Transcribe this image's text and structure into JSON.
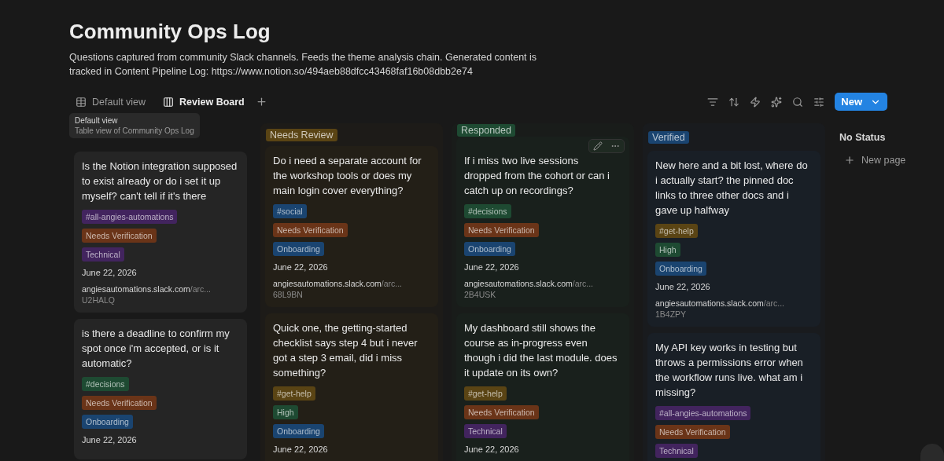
{
  "page": {
    "title": "Community Ops Log",
    "description": "Questions captured from community Slack channels. Feeds the theme analysis chain. Generated content is tracked in Content Pipeline Log: https://www.notion.so/494aeb88dfcc43468faf16b08dbb2e74"
  },
  "views": [
    {
      "kind": "table",
      "label": "Default view",
      "selected": false
    },
    {
      "kind": "board",
      "label": "Review Board",
      "selected": true
    }
  ],
  "new_button": {
    "label": "New"
  },
  "tooltip": {
    "title": "Default view",
    "subtitle": "Table view of Community Ops Log"
  },
  "columns": [
    {
      "cards": [
        {
          "question": "Is the Notion integration supposed to exist already or do i set it up myself? can't tell if it's there",
          "tags": [
            {
              "label": "#all-angies-automations",
              "color": "#42245e"
            },
            {
              "label": "Needs Verification",
              "color": "#6a3418"
            },
            {
              "label": "Technical",
              "color": "#42245e"
            }
          ],
          "date": "June 22, 2026",
          "url_host": "angiesautomations.slack.com",
          "url_path": "/arc...",
          "ref": "U2HALQ",
          "hover_actions": false
        },
        {
          "question": "is there a deadline to confirm my spot once i'm accepted, or is it automatic?",
          "tags": [
            {
              "label": "#decisions",
              "color": "#1e4a32"
            },
            {
              "label": "Needs Verification",
              "color": "#6a3418"
            },
            {
              "label": "Onboarding",
              "color": "#1a4470"
            }
          ],
          "date": "June 22, 2026",
          "hover_actions": false
        }
      ]
    },
    {
      "status": "Needs Review",
      "color": "#5a4414",
      "cards": [
        {
          "question": "Do i need a separate account for the workshop tools or does my main login cover everything?",
          "tags": [
            {
              "label": "#social",
              "color": "#1a4470"
            },
            {
              "label": "Needs Verification",
              "color": "#6a3418"
            },
            {
              "label": "Onboarding",
              "color": "#1a4470"
            }
          ],
          "date": "June 22, 2026",
          "url_host": "angiesautomations.slack.com",
          "url_path": "/arc...",
          "ref": "68L9BN",
          "hover_actions": false
        },
        {
          "question": "Quick one, the getting-started checklist says step 4 but i never got a step 3 email, did i miss something?",
          "tags": [
            {
              "label": "#get-help",
              "color": "#5a4414"
            },
            {
              "label": "High",
              "color": "#1e4a32"
            },
            {
              "label": "Onboarding",
              "color": "#1a4470"
            }
          ],
          "date": "June 22, 2026",
          "hover_actions": false
        }
      ]
    },
    {
      "status": "Responded",
      "color": "#1e4a32",
      "cards": [
        {
          "question": "If i miss two live sessions\ndropped from the cohort or can i catch up on recordings?",
          "tags": [
            {
              "label": "#decisions",
              "color": "#1e4a32"
            },
            {
              "label": "Needs Verification",
              "color": "#6a3418"
            },
            {
              "label": "Onboarding",
              "color": "#1a4470"
            }
          ],
          "date": "June 22, 2026",
          "url_host": "angiesautomations.slack.com",
          "url_path": "/arc...",
          "ref": "2B4USK",
          "hover_actions": true
        },
        {
          "question": "My dashboard still shows the course as in-progress even though i did the last module. does it update on its own?",
          "tags": [
            {
              "label": "#get-help",
              "color": "#5a4414"
            },
            {
              "label": "Needs Verification",
              "color": "#6a3418"
            },
            {
              "label": "Technical",
              "color": "#42245e"
            }
          ],
          "date": "June 22, 2026",
          "hover_actions": false
        }
      ]
    },
    {
      "status": "Verified",
      "color": "#1a4470",
      "cards": [
        {
          "question": "New here and a bit lost, where do i actually start? the pinned doc links to three other docs and i gave up halfway",
          "tags": [
            {
              "label": "#get-help",
              "color": "#5a4414"
            },
            {
              "label": "High",
              "color": "#1e4a32"
            },
            {
              "label": "Onboarding",
              "color": "#1a4470"
            }
          ],
          "date": "June 22, 2026",
          "url_host": "angiesautomations.slack.com",
          "url_path": "/arc...",
          "ref": "1B4ZPY",
          "hover_actions": false
        },
        {
          "question": "My API key works in testing but throws a permissions error when the workflow runs live. what am i missing?",
          "tags": [
            {
              "label": "#all-angies-automations",
              "color": "#42245e"
            },
            {
              "label": "Needs Verification",
              "color": "#6a3418"
            },
            {
              "label": "Technical",
              "color": "#42245e"
            }
          ],
          "hover_actions": false
        }
      ]
    },
    {
      "status": "No Status",
      "add_label": "New page"
    }
  ]
}
